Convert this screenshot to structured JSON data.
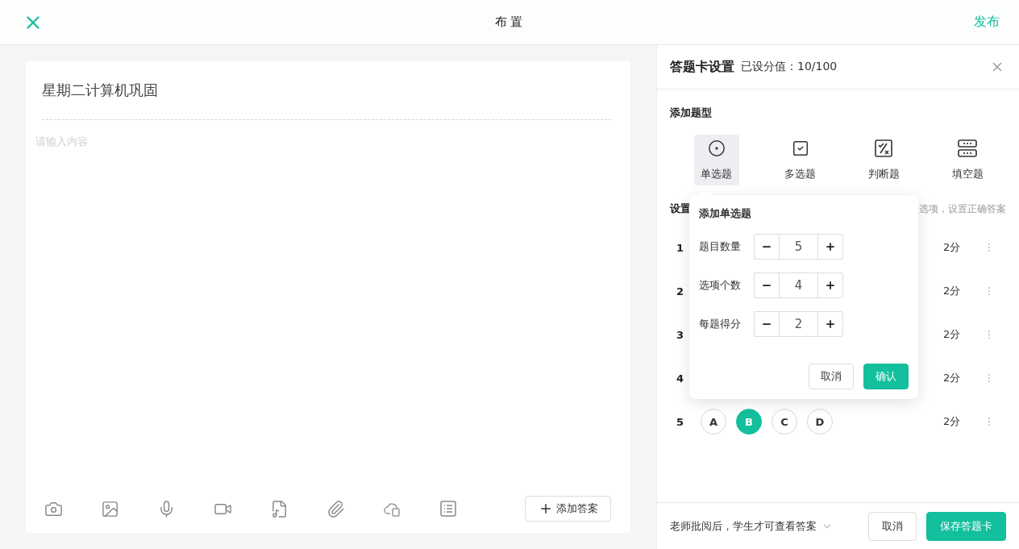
{
  "header": {
    "title": "布 置",
    "publish": "发布"
  },
  "editor": {
    "title": "星期二计算机巩固",
    "placeholder": "请输入内容",
    "add_answer": "添加答案"
  },
  "panel": {
    "title": "答题卡设置",
    "score_total": "已设分值：10/100",
    "add_type_heading": "添加题型",
    "types": [
      {
        "label": "单选题",
        "selected": true
      },
      {
        "label": "多选题",
        "selected": false
      },
      {
        "label": "判断题",
        "selected": false
      },
      {
        "label": "填空题",
        "selected": false
      }
    ],
    "settings_heading": "设置",
    "settings_hint": "选项，设置正确答案",
    "rows": [
      {
        "number": "1",
        "score": "2分"
      },
      {
        "number": "2",
        "score": "2分"
      },
      {
        "number": "3",
        "score": "2分"
      },
      {
        "number": "4",
        "score": "2分"
      },
      {
        "number": "5",
        "score": "2分",
        "options": [
          {
            "label": "A",
            "selected": false
          },
          {
            "label": "B",
            "selected": true
          },
          {
            "label": "C",
            "selected": false
          },
          {
            "label": "D",
            "selected": false
          }
        ]
      }
    ],
    "footer": {
      "visibility": "老师批阅后，学生才可查看答案",
      "cancel": "取消",
      "save": "保存答题卡"
    }
  },
  "popup": {
    "title": "添加单选题",
    "fields": [
      {
        "label": "题目数量",
        "value": "5"
      },
      {
        "label": "选项个数",
        "value": "4"
      },
      {
        "label": "每题得分",
        "value": "2"
      }
    ],
    "cancel": "取消",
    "confirm": "确认"
  }
}
